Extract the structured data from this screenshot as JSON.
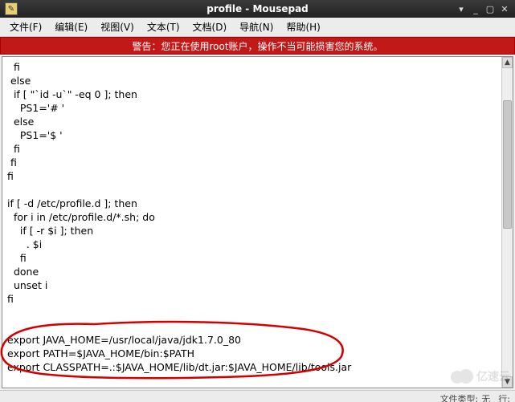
{
  "window": {
    "title": "profile - Mousepad"
  },
  "menu": {
    "file": "文件(F)",
    "edit": "编辑(E)",
    "view": "视图(V)",
    "text": "文本(T)",
    "document": "文档(D)",
    "nav": "导航(N)",
    "help": "帮助(H)"
  },
  "warning": "警告：您正在使用root账户，操作不当可能损害您的系统。",
  "editor": {
    "content": "  fi\n else\n  if [ \"`id -u`\" -eq 0 ]; then\n    PS1='# '\n  else\n    PS1='$ '\n  fi\n fi\nfi\n\nif [ -d /etc/profile.d ]; then\n  for i in /etc/profile.d/*.sh; do\n    if [ -r $i ]; then\n      . $i\n    fi\n  done\n  unset i\nfi\n\n\nexport JAVA_HOME=/usr/local/java/jdk1.7.0_80\nexport PATH=$JAVA_HOME/bin:$PATH\nexport CLASSPATH=.:$JAVA_HOME/lib/dt.jar:$JAVA_HOME/lib/tools.jar"
  },
  "status": {
    "filetype_label": "文件类型:",
    "filetype_value": "无",
    "line_label": "行:"
  },
  "watermark": "亿速云"
}
